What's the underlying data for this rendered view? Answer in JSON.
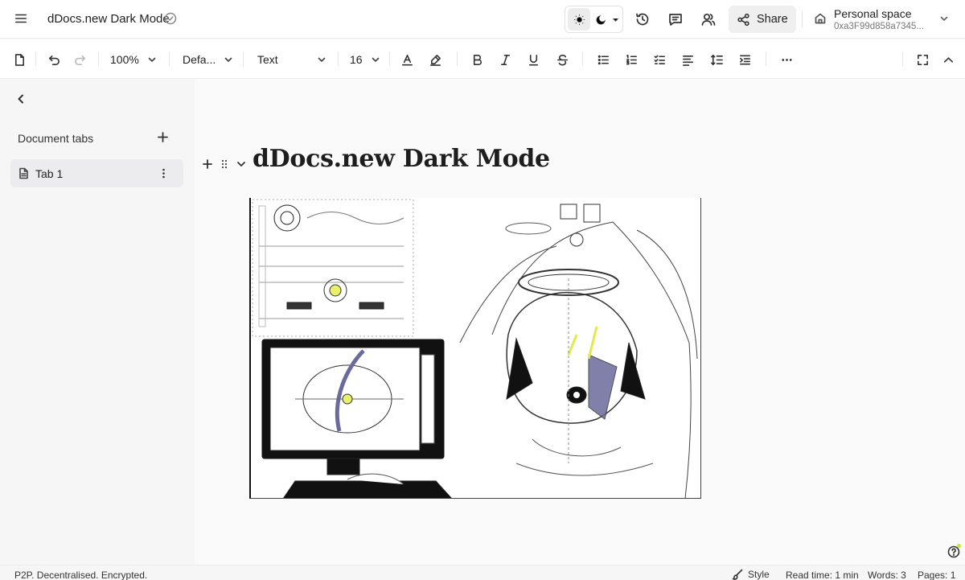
{
  "header": {
    "title": "dDocs.new Dark Mode",
    "share_label": "Share",
    "space_name": "Personal space",
    "space_address": "0xa3F99d858a7345..."
  },
  "toolbar": {
    "zoom": "100%",
    "font": "Defa...",
    "block_type": "Text",
    "font_size": "16"
  },
  "sidebar": {
    "heading": "Document tabs",
    "tabs": [
      {
        "label": "Tab 1"
      }
    ]
  },
  "document": {
    "heading": "dDocs.new Dark Mode"
  },
  "status": {
    "tagline": "P2P. Decentralised. Encrypted.",
    "style_label": "Style",
    "read_time": "Read time: 1 min",
    "words": "Words: 3",
    "pages": "Pages: 1"
  },
  "colors": {
    "accent_dot": "#c8e23c",
    "sidebar_bg": "#f6f6f7",
    "toolbar_bg": "#ffffff"
  },
  "icons": [
    "menu-icon",
    "verified-icon",
    "sun-icon",
    "moon-icon",
    "history-icon",
    "comment-icon",
    "collaborators-icon",
    "share-icon",
    "home-icon",
    "document-icon",
    "undo-icon",
    "redo-icon",
    "text-color-icon",
    "highlight-icon",
    "bold-icon",
    "italic-icon",
    "underline-icon",
    "strikethrough-icon",
    "bullet-list-icon",
    "numbered-list-icon",
    "checklist-icon",
    "align-icon",
    "line-height-icon",
    "indent-icon",
    "more-icon",
    "fullscreen-icon",
    "collapse-icon",
    "help-icon"
  ]
}
